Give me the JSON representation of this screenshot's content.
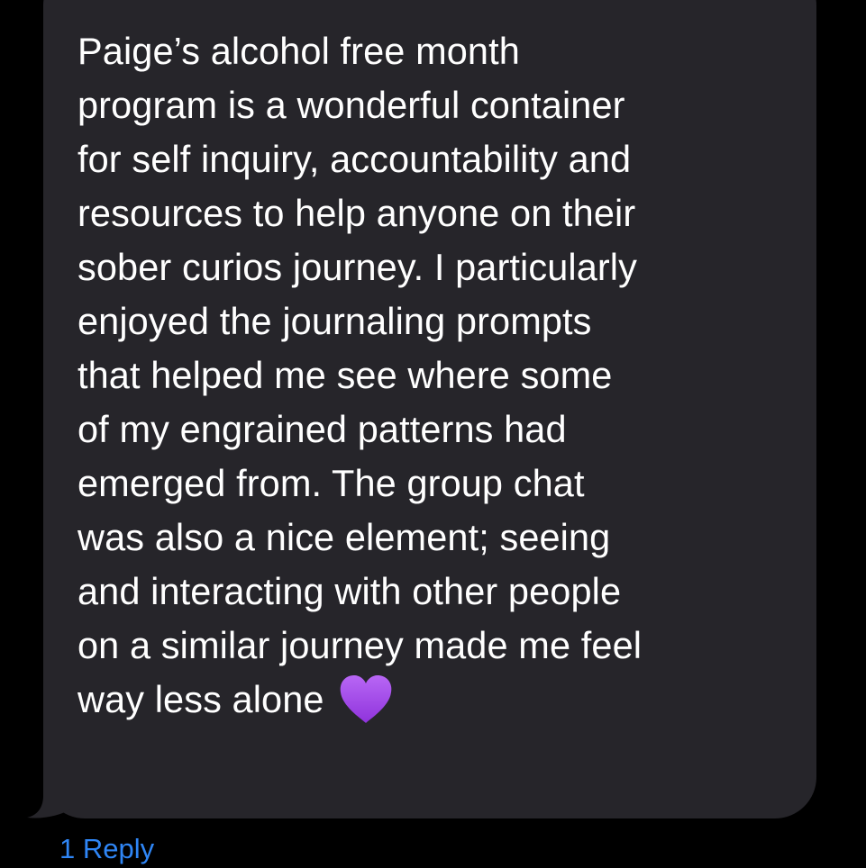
{
  "message": {
    "lines": [
      "Paige’s alcohol free month",
      "program is a wonderful container",
      "for self inquiry, accountability and",
      "resources to help anyone on their",
      "sober curios journey. I particularly",
      "enjoyed the journaling prompts",
      "that helped me see where some",
      "of my engrained patterns had",
      "emerged from. The group chat",
      "was also a nice element; seeing",
      "and interacting with other people",
      "on a similar journey made me feel",
      "way less alone"
    ],
    "emoji": "purple-heart-icon"
  },
  "thread": {
    "reply_label": "1 Reply"
  },
  "colors": {
    "background": "#000000",
    "bubble": "#26252a",
    "text": "#ffffff",
    "link": "#2f86f6",
    "heart": "#a24de8"
  }
}
